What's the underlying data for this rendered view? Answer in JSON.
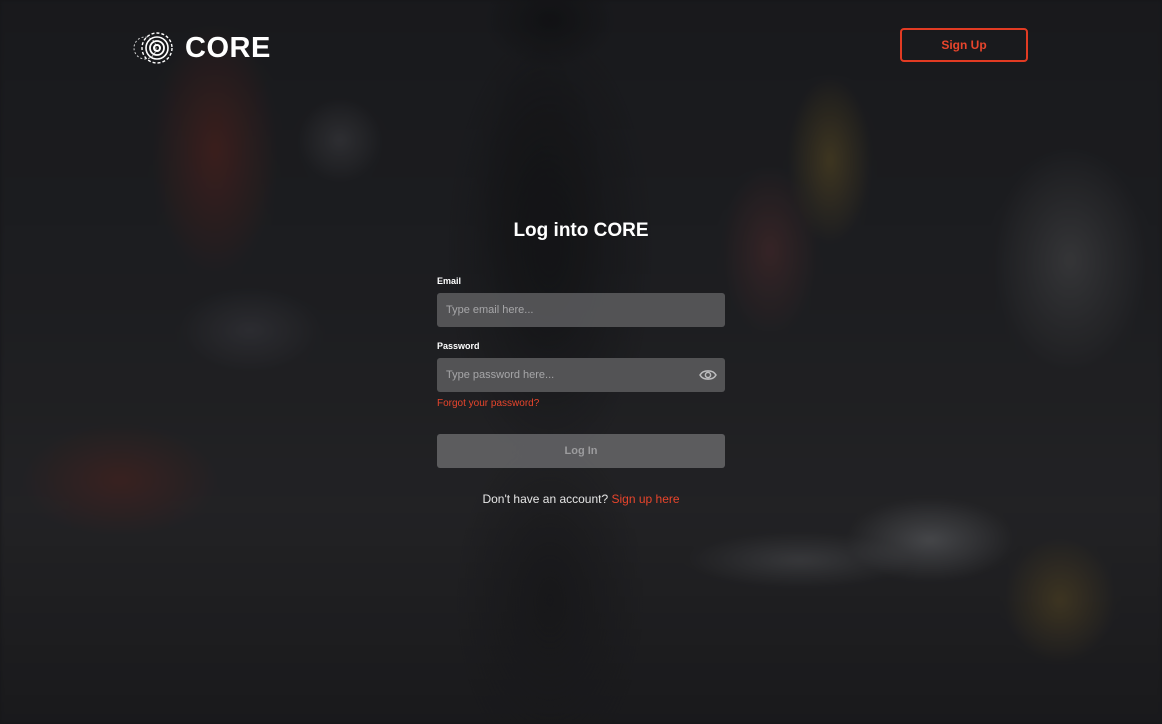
{
  "header": {
    "brand": "CORE",
    "signup_label": "Sign Up"
  },
  "form": {
    "title": "Log into CORE",
    "email": {
      "label": "Email",
      "placeholder": "Type email here..."
    },
    "password": {
      "label": "Password",
      "placeholder": "Type password here...",
      "toggle_icon": "eye-icon"
    },
    "forgot_label": "Forgot your password?",
    "login_label": "Log In",
    "no_account_text": "Don't have an account?",
    "signup_link_label": "Sign up here"
  },
  "colors": {
    "accent": "#e8452c",
    "input_bg": "#58585a",
    "button_disabled_bg": "#646466"
  }
}
